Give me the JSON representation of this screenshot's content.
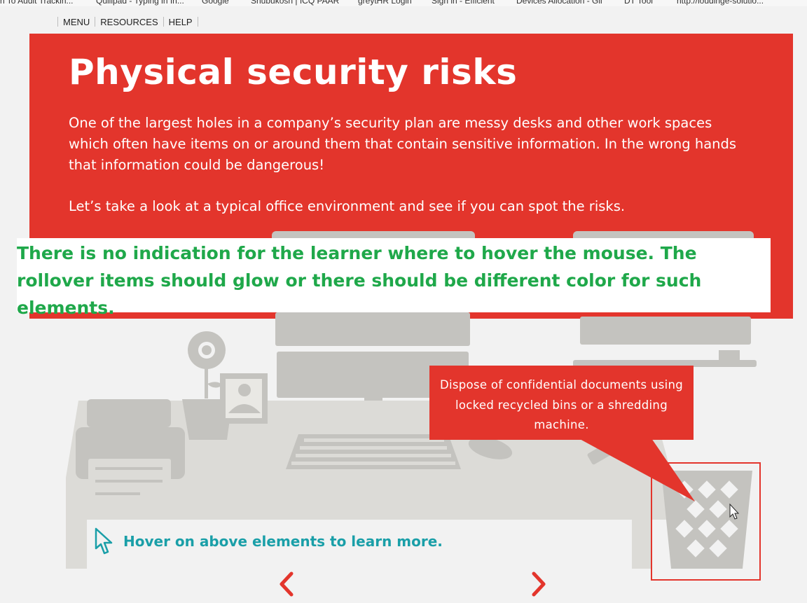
{
  "browser": {
    "bookmarks": [
      "n To Audit Trackin...",
      "Quillpad - Typing in In...",
      "Google",
      "Shubukosh | ICQ PAAR",
      "greytHR Login",
      "Sign in - Efficient",
      "Devices Allocation - Gil",
      "DT Tool",
      "http://loudinge-solutio..."
    ]
  },
  "topnav": {
    "menu_label": "MENU",
    "resources_label": "RESOURCES",
    "help_label": "HELP"
  },
  "hero": {
    "title": "Physical security risks",
    "paragraph1": "One of the largest holes in a company’s security plan are messy desks and other work spaces which often have items on or around them that contain sensitive information. In the wrong hands that information could be dangerous!",
    "paragraph2": "Let’s take a look at a typical office environment and see if you can spot the risks."
  },
  "annotation": {
    "text": "There is no indication for the learner where to hover the mouse. The rollover items should glow or there should be different color for such elements."
  },
  "tooltip": {
    "text": "Dispose of confidential documents using locked recycled bins or a shredding machine."
  },
  "hint": {
    "text": "Hover on above elements to learn more."
  },
  "colors": {
    "accent_red": "#e3352c",
    "illustration_grey": "#c4c3bf",
    "hint_teal": "#1a9fa8",
    "annotation_green": "#1fa84a"
  },
  "icons": {
    "prev": "chevron-left-icon",
    "next": "chevron-right-icon",
    "hint": "cursor-arrow-icon"
  }
}
